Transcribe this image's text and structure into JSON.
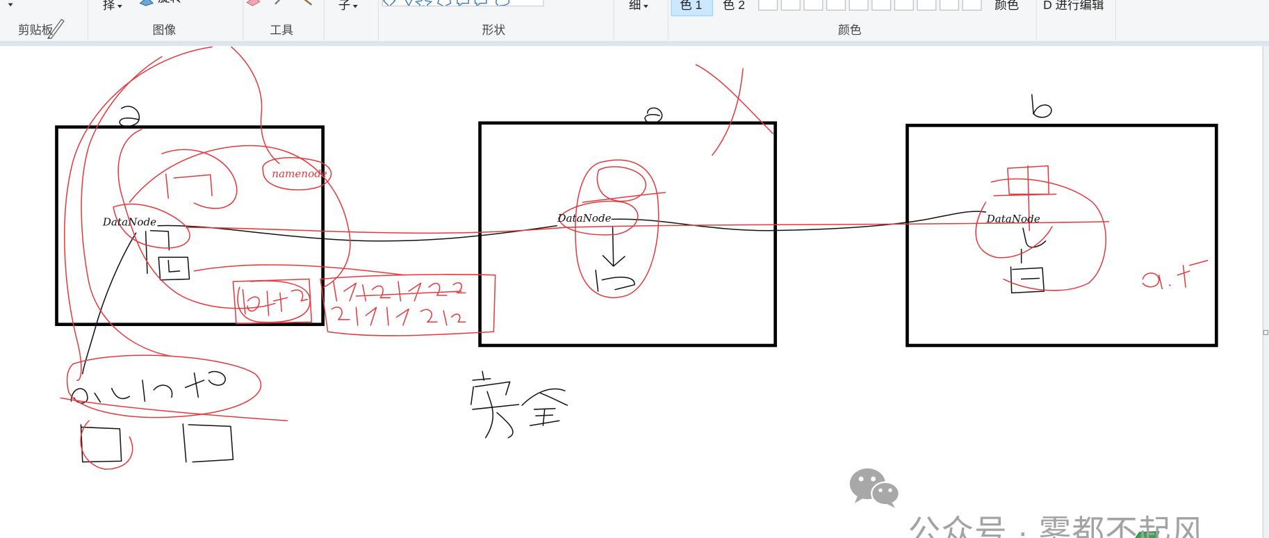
{
  "ribbon": {
    "clipboard": {
      "label": "剪贴板"
    },
    "image": {
      "select_label": "择",
      "rotate_label": "旋转",
      "label": "图像"
    },
    "tools": {
      "label": "工具"
    },
    "brushes": {
      "label": "子"
    },
    "shapes": {
      "label": "形状"
    },
    "size": {
      "label": "细"
    },
    "colors": {
      "color1_label": "色 1",
      "color2_label": "色 2",
      "edit_label": "颜色",
      "label": "颜色"
    },
    "paint3d": {
      "label": "D 进行编辑"
    }
  },
  "canvas": {
    "nodes": [
      {
        "label": "DataNode"
      },
      {
        "label": "DataNode"
      },
      {
        "label": "DataNode"
      }
    ],
    "namenode_label": "namenode",
    "ink_colors": {
      "black": "#111111",
      "red": "#e8373c"
    }
  },
  "watermark": {
    "text": "公众号 · 雾都不起风",
    "icon": "wechat-icon"
  },
  "theme": {
    "ribbon_bg": "#f5f6f7",
    "selected_color_bg": "#cce8ff",
    "accent": "#99d1ff"
  }
}
